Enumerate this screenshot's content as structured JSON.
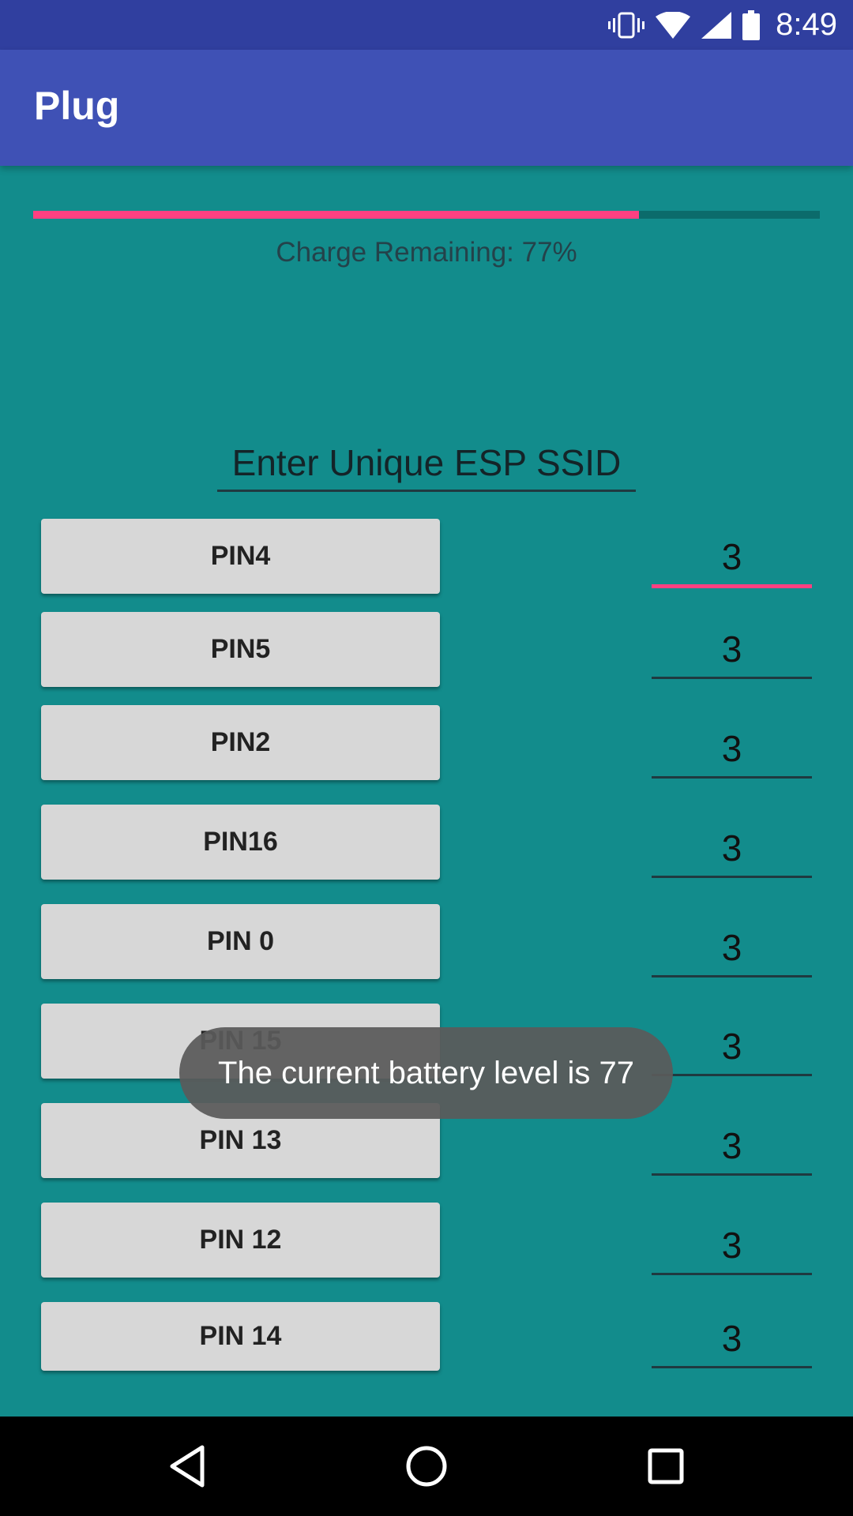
{
  "status_bar": {
    "time": "8:49",
    "icons": [
      "vibrate-icon",
      "wifi-icon",
      "signal-icon",
      "battery-icon"
    ]
  },
  "app_bar": {
    "title": "Plug"
  },
  "battery": {
    "progress_fraction": 0.77,
    "charge_label": "Charge Remaining: 77%"
  },
  "ssid_input": {
    "placeholder": "Enter Unique ESP SSID",
    "value": ""
  },
  "pins": [
    {
      "label": "PIN4",
      "value": "3"
    },
    {
      "label": "PIN5",
      "value": "3"
    },
    {
      "label": "PIN2",
      "value": "3"
    },
    {
      "label": "PIN16",
      "value": "3"
    },
    {
      "label": "PIN 0",
      "value": "3"
    },
    {
      "label": "PIN 15",
      "value": "3"
    },
    {
      "label": "PIN 13",
      "value": "3"
    },
    {
      "label": "PIN 12",
      "value": "3"
    },
    {
      "label": "PIN 14",
      "value": "3"
    }
  ],
  "toast": {
    "message": "The current battery level is 77"
  },
  "nav_bar": {
    "buttons": [
      "back-icon",
      "home-icon",
      "recents-icon"
    ]
  },
  "colors": {
    "status_bar": "#303f9f",
    "app_bar": "#3f51b5",
    "background": "#128c8c",
    "accent": "#ff4081"
  }
}
